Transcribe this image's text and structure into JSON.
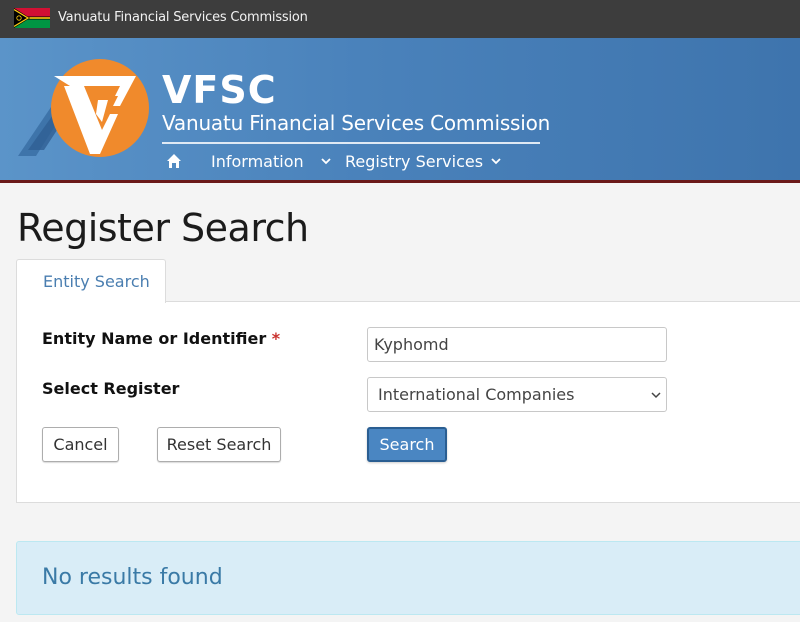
{
  "topbar": {
    "title": "Vanuatu Financial Services Commission",
    "flag_icon": "vanuatu-flag-icon"
  },
  "header": {
    "logo_icon": "vfsc-logo-icon",
    "brand": "VFSC",
    "brand_subtitle": "Vanuatu Financial Services Commission",
    "nav": {
      "home_icon": "home-icon",
      "items": [
        {
          "label": "Information",
          "icon": "chevron-down-icon"
        },
        {
          "label": "Registry Services",
          "icon": "chevron-down-icon"
        }
      ]
    },
    "colors": {
      "banner": "#4a82bb",
      "accent_line": "#6b1a1a"
    }
  },
  "main": {
    "title": "Register Search",
    "tabs": [
      {
        "label": "Entity Search",
        "active": true
      }
    ],
    "form": {
      "entity_label": "Entity Name or Identifier",
      "required_marker": "*",
      "entity_value": "Kyphomd",
      "register_label": "Select Register",
      "register_selected": "International Companies",
      "cancel_label": "Cancel",
      "reset_label": "Reset Search",
      "search_label": "Search"
    },
    "alert": {
      "text": "No results found"
    }
  }
}
